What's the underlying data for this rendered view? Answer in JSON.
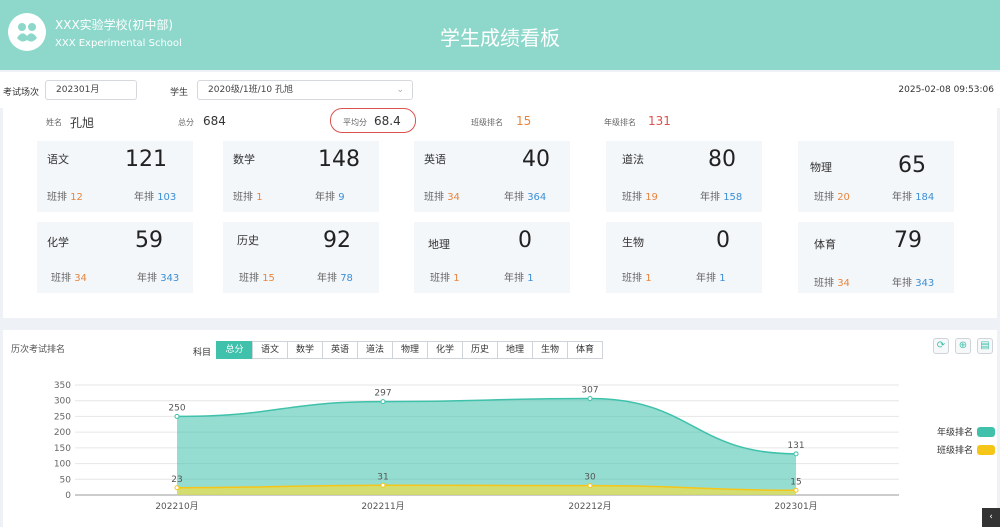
{
  "header": {
    "school_name": "XXX实验学校(初中部)",
    "school_name_en": "XXX Experimental School",
    "title": "学生成绩看板"
  },
  "filters": {
    "exam_label": "考试场次",
    "exam_value": "202301月",
    "student_label": "学生",
    "student_value": "2020级/1班/10 孔旭",
    "datetime": "2025-02-08 09:53:06"
  },
  "summary": {
    "name_label": "姓名",
    "name_value": "孔旭",
    "total_label": "总分",
    "total_value": "684",
    "avg_label": "平均分",
    "avg_value": "68.4",
    "class_rank_label": "班级排名",
    "class_rank_value": "15",
    "grade_rank_label": "年级排名",
    "grade_rank_value": "131"
  },
  "rank_labels": {
    "class": "班排",
    "grade": "年排"
  },
  "subjects": [
    {
      "name": "语文",
      "score": "121",
      "class_rank": "12",
      "grade_rank": "103"
    },
    {
      "name": "数学",
      "score": "148",
      "class_rank": "1",
      "grade_rank": "9"
    },
    {
      "name": "英语",
      "score": "40",
      "class_rank": "34",
      "grade_rank": "364"
    },
    {
      "name": "道法",
      "score": "80",
      "class_rank": "19",
      "grade_rank": "158"
    },
    {
      "name": "物理",
      "score": "65",
      "class_rank": "20",
      "grade_rank": "184"
    },
    {
      "name": "化学",
      "score": "59",
      "class_rank": "34",
      "grade_rank": "343"
    },
    {
      "name": "历史",
      "score": "92",
      "class_rank": "15",
      "grade_rank": "78"
    },
    {
      "name": "地理",
      "score": "0",
      "class_rank": "1",
      "grade_rank": "1"
    },
    {
      "name": "生物",
      "score": "0",
      "class_rank": "1",
      "grade_rank": "1"
    },
    {
      "name": "体育",
      "score": "79",
      "class_rank": "34",
      "grade_rank": "343"
    }
  ],
  "history": {
    "title": "历次考试排名",
    "subject_label": "科目",
    "tabs": [
      "总分",
      "语文",
      "数学",
      "英语",
      "道法",
      "物理",
      "化学",
      "历史",
      "地理",
      "生物",
      "体育"
    ],
    "active_tab": "总分"
  },
  "icons": {
    "refresh": "refresh-icon",
    "zoom": "zoom-icon",
    "download": "document-icon"
  },
  "colors": {
    "header": "#8dd8cb",
    "accent": "#3fc1ab",
    "grade_series": "#3fc1ab",
    "class_series": "#f5c518",
    "orange": "#e8853d",
    "blue": "#3b8fd6",
    "avg_outline": "#d9534f"
  },
  "chart_data": {
    "type": "area",
    "categories": [
      "202210月",
      "202211月",
      "202212月",
      "202301月"
    ],
    "series": [
      {
        "name": "年级排名",
        "values": [
          250,
          297,
          307,
          131
        ]
      },
      {
        "name": "班级排名",
        "values": [
          23,
          31,
          30,
          15
        ]
      }
    ],
    "yticks": [
      "0",
      "50",
      "100",
      "150",
      "200",
      "250",
      "300",
      "350"
    ],
    "ylim": [
      0,
      350
    ],
    "grid": true,
    "legend": "right"
  }
}
